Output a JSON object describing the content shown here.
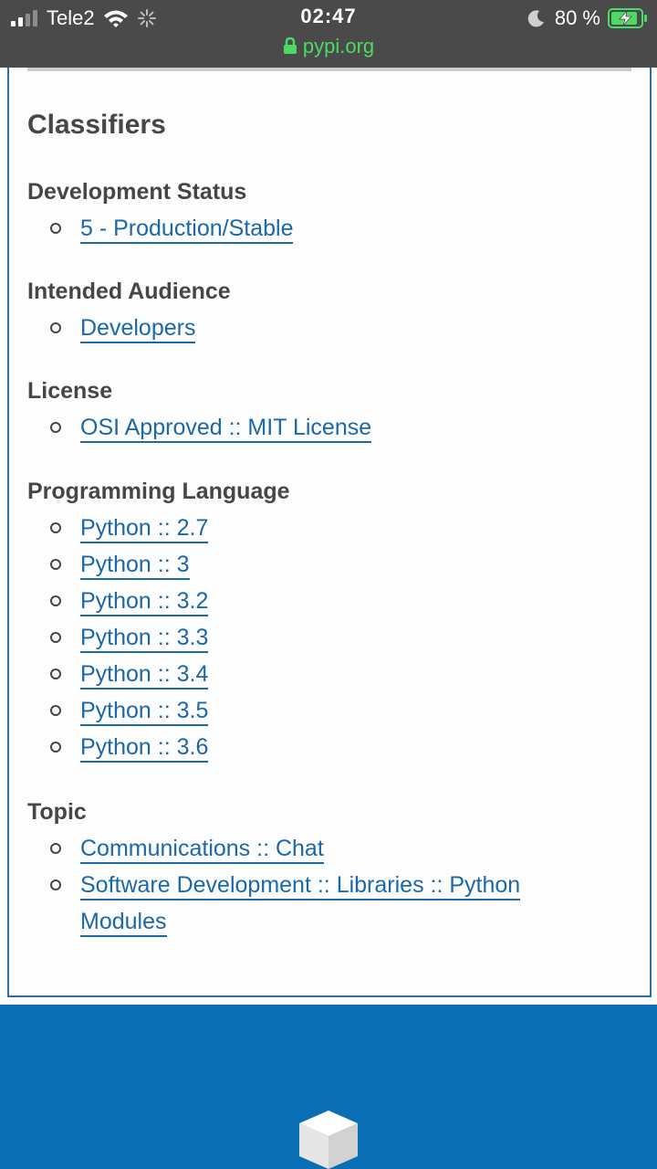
{
  "status_bar": {
    "carrier": "Tele2",
    "time": "02:47",
    "url": "pypi.org",
    "battery": "80 %"
  },
  "section_title": "Classifiers",
  "groups": [
    {
      "title": "Development Status",
      "items": [
        "5 - Production/Stable"
      ]
    },
    {
      "title": "Intended Audience",
      "items": [
        "Developers"
      ]
    },
    {
      "title": "License",
      "items": [
        "OSI Approved :: MIT License"
      ]
    },
    {
      "title": "Programming Language",
      "items": [
        "Python :: 2.7",
        "Python :: 3",
        "Python :: 3.2",
        "Python :: 3.3",
        "Python :: 3.4",
        "Python :: 3.5",
        "Python :: 3.6"
      ]
    },
    {
      "title": "Topic",
      "items": [
        "Communications :: Chat",
        "Software Development :: Libraries :: Python",
        "Modules"
      ]
    }
  ],
  "colors": {
    "link": "#1b68a9",
    "footer": "#0a6eb4",
    "url": "#4cd964"
  }
}
